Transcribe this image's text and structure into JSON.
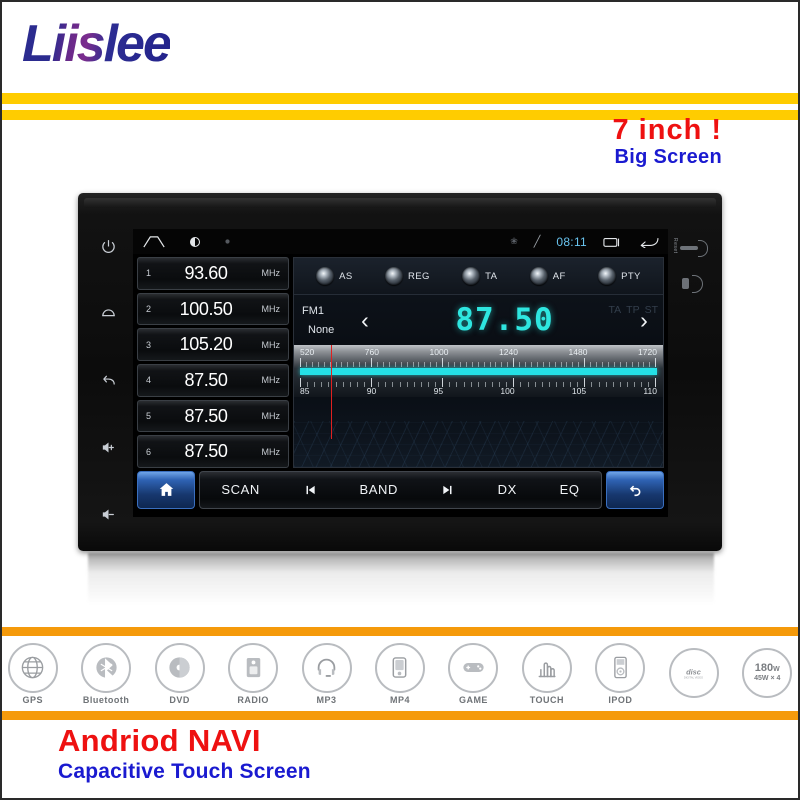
{
  "header": {
    "brand": "Liislee",
    "inch_label": "7 inch !",
    "big_screen_label": "Big Screen"
  },
  "footer": {
    "title": "Andriod NAVI",
    "subtitle": "Capacitive Touch Screen"
  },
  "device": {
    "bezel_left_buttons": [
      {
        "name": "power-icon",
        "label": "power"
      },
      {
        "name": "home-icon",
        "label": "home"
      },
      {
        "name": "back-icon",
        "label": "back"
      },
      {
        "name": "volume-up-icon",
        "label": "volume up"
      },
      {
        "name": "volume-down-icon",
        "label": "volume down"
      }
    ],
    "bezel_right": {
      "reset_label": "Reset"
    }
  },
  "screen": {
    "statusbar": {
      "home_icon": "home-outline-icon",
      "brightness_icon": "brightness-icon",
      "dot_icon": "dot-icon",
      "bluetooth_icon": "bluetooth-icon",
      "signal_icon": "signal-icon",
      "time": "08:11",
      "recents_icon": "recents-icon",
      "back_icon": "back-arrow-icon"
    },
    "presets": [
      {
        "num": "1",
        "freq": "93.60",
        "unit": "MHz"
      },
      {
        "num": "2",
        "freq": "100.50",
        "unit": "MHz"
      },
      {
        "num": "3",
        "freq": "105.20",
        "unit": "MHz"
      },
      {
        "num": "4",
        "freq": "87.50",
        "unit": "MHz"
      },
      {
        "num": "5",
        "freq": "87.50",
        "unit": "MHz"
      },
      {
        "num": "6",
        "freq": "87.50",
        "unit": "MHz"
      }
    ],
    "rds_buttons": [
      {
        "label": "AS"
      },
      {
        "label": "REG"
      },
      {
        "label": "TA"
      },
      {
        "label": "AF"
      },
      {
        "label": "PTY"
      }
    ],
    "tuner": {
      "band": "FM1",
      "pty": "None",
      "frequency": "87.50",
      "prev_arrow": "‹",
      "next_arrow": "›",
      "flags": [
        "TA",
        "TP",
        "ST"
      ],
      "am_scale_labels": [
        "520",
        "760",
        "1000",
        "1240",
        "1480",
        "1720"
      ],
      "fm_scale_labels": [
        "85",
        "90",
        "95",
        "100",
        "105",
        "110"
      ],
      "needle_percent": 10,
      "accent_color": "#24e0e6",
      "needle_color": "#e02020"
    },
    "toolbar": {
      "home_icon": "home-solid-icon",
      "items": [
        {
          "type": "text",
          "label": "SCAN"
        },
        {
          "type": "icon",
          "label": "prev-track-icon"
        },
        {
          "type": "text",
          "label": "BAND"
        },
        {
          "type": "icon",
          "label": "next-track-icon"
        },
        {
          "type": "text",
          "label": "DX"
        },
        {
          "type": "text",
          "label": "EQ"
        }
      ],
      "back_icon": "back-curved-icon"
    }
  },
  "features": [
    {
      "label": "GPS",
      "icon": "globe-icon"
    },
    {
      "label": "Bluetooth",
      "icon": "bluetooth-icon"
    },
    {
      "label": "DVD",
      "icon": "disc-icon"
    },
    {
      "label": "RADIO",
      "icon": "radio-icon"
    },
    {
      "label": "MP3",
      "icon": "headset-icon"
    },
    {
      "label": "MP4",
      "icon": "media-player-icon"
    },
    {
      "label": "GAME",
      "icon": "gamepad-icon"
    },
    {
      "label": "TOUCH",
      "icon": "hand-touch-icon"
    },
    {
      "label": "IPOD",
      "icon": "ipod-icon"
    },
    {
      "label": "",
      "icon": "cd-disc-logo-icon"
    },
    {
      "label": "",
      "icon": "power-rating-icon",
      "power_main": "180",
      "power_unit": "W",
      "power_sub": "45W × 4"
    }
  ],
  "colors": {
    "yellow_bar": "#ffcc00",
    "orange_bar": "#f59a0b",
    "red_text": "#ee1111",
    "blue_text": "#1a1ad0"
  }
}
